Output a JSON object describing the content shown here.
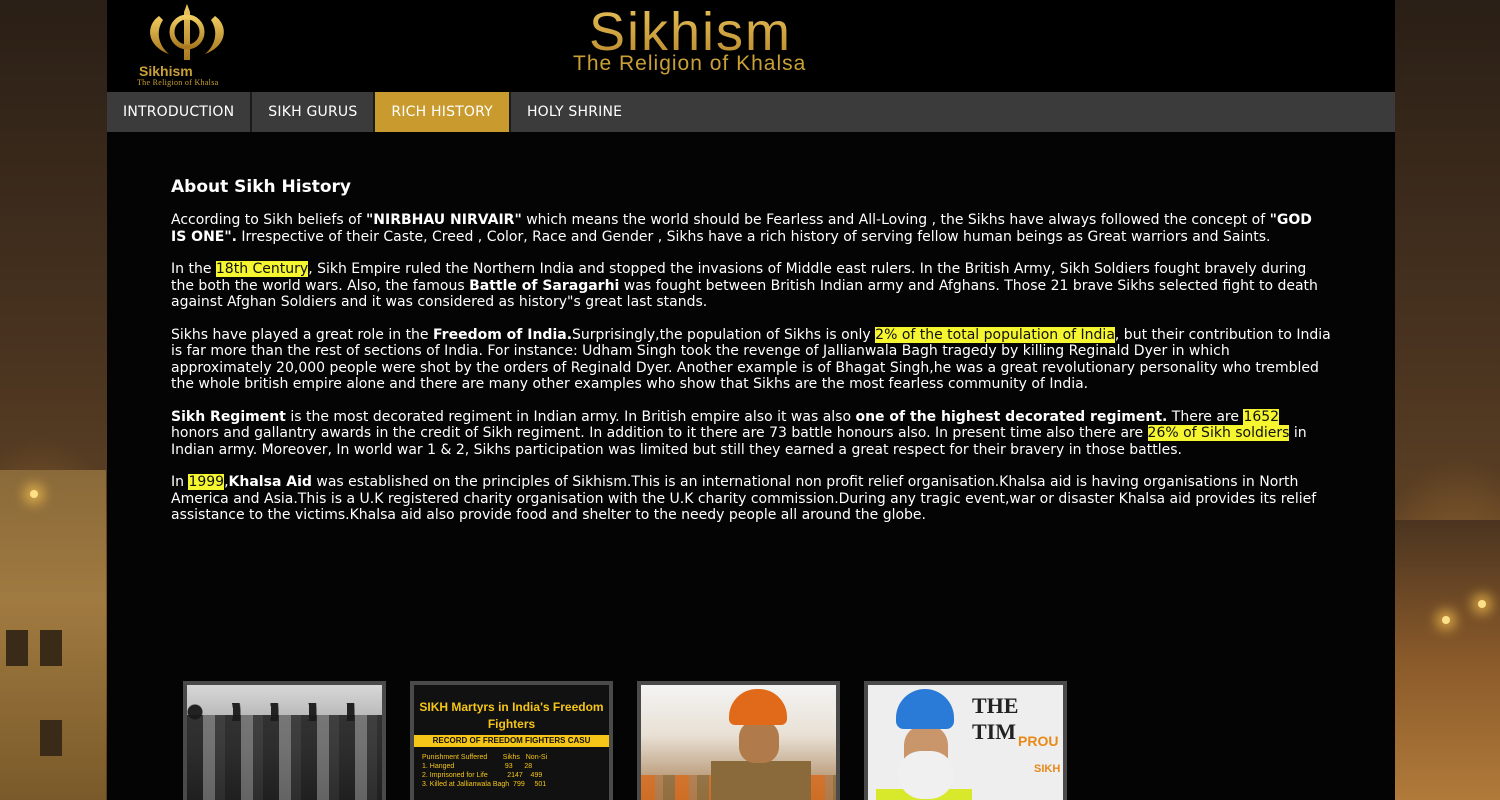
{
  "header": {
    "logo_text": "Sikhism",
    "logo_subtext": "The Religion of Khalsa",
    "title": "Sikhism",
    "tagline": "The Religion of Khalsa"
  },
  "nav": {
    "items": [
      {
        "label": "INTRODUCTION",
        "active": false
      },
      {
        "label": "SIKH GURUS",
        "active": false
      },
      {
        "label": "RICH HISTORY",
        "active": true
      },
      {
        "label": "HOLY SHRINE",
        "active": false
      }
    ]
  },
  "main": {
    "heading": "About Sikh History",
    "p1": {
      "a": "According to Sikh beliefs of ",
      "b1": "\"NIRBHAU NIRVAIR\"",
      "c": " which means the world should be Fearless and All-Loving , the Sikhs have always followed the concept of ",
      "b2": "\"GOD IS ONE\".",
      "d": " Irrespective of their Caste, Creed , Color, Race and Gender , Sikhs have a rich history of serving fellow human beings as Great warriors and Saints."
    },
    "p2": {
      "a": "In the ",
      "hl1": "18th Century",
      "b": ", Sikh Empire ruled the Northern India and stopped the invasions of Middle east rulers. In the British Army, Sikh Soldiers fought bravely during the both the world wars. Also, the famous ",
      "b1": "Battle of Saragarhi",
      "c": " was fought between British Indian army and Afghans. Those 21 brave Sikhs selected fight to death against Afghan Soldiers and it was considered as history\"s great last stands."
    },
    "p3": {
      "a": "Sikhs have played a great role in the ",
      "b1": "Freedom of India.",
      "b": "Surprisingly,the population of Sikhs is only ",
      "hl1": "2% of the total population of India",
      "c": ", but their contribution to India is far more than the rest of sections of India. For instance: Udham Singh took the revenge of Jallianwala Bagh tragedy by killing Reginald Dyer in which approximately 20,000 people were shot by the orders of Reginald Dyer. Another example is of Bhagat Singh,he was a great revolutionary personality who trembled the whole british empire alone and there are many other examples who show that Sikhs are the most fearless community of India."
    },
    "p4": {
      "b1": "Sikh Regiment",
      "a": " is the most decorated regiment in Indian army. In British empire also it was also ",
      "b2": "one of the highest decorated regiment.",
      "b": " There are ",
      "hl1": "1652",
      "c": " honors and gallantry awards in the credit of Sikh regiment. In addition to it there are 73 battle honours also. In present time also there are ",
      "hl2": "26% of Sikh soldiers",
      "d": " in Indian army. Moreover, In world war 1 & 2, Sikhs participation was limited but still they earned a great respect for their bravery in those battles."
    },
    "p5": {
      "a": "In ",
      "hl1": "1999",
      "b": ",",
      "b1": "Khalsa Aid",
      "c": " was established on the principles of Sikhism.This is an international non profit relief organisation.Khalsa aid is having organisations in North America and Asia.This is a U.K registered charity organisation with the U.K charity commission.During any tragic event,war or disaster Khalsa aid provides its relief assistance to the victims.Khalsa aid also provide food and shelter to the needy people all around the globe."
    }
  },
  "gallery": {
    "thumb2_title": "SIKH Martyrs in India's Freedom Fighters",
    "thumb2_bar": "RECORD OF FREEDOM FIGHTERS CASU",
    "thumb2_cols": "Punishment Suffered        Sikhs   Non-Si",
    "thumb2_row1": "1. Hanged                          93      28",
    "thumb2_row2": "2. Imprisoned for Life          2147    499",
    "thumb2_row3": "3. Killed at Jallianwala Bagh  799     501",
    "thumb4_paper": "THE TIM",
    "thumb4_proud": "PROU",
    "thumb4_sikh": "SIKH"
  },
  "colors": {
    "accent_gold": "#c99a2e",
    "highlight": "#f5f530",
    "nav_bg": "#3b3b3b"
  }
}
